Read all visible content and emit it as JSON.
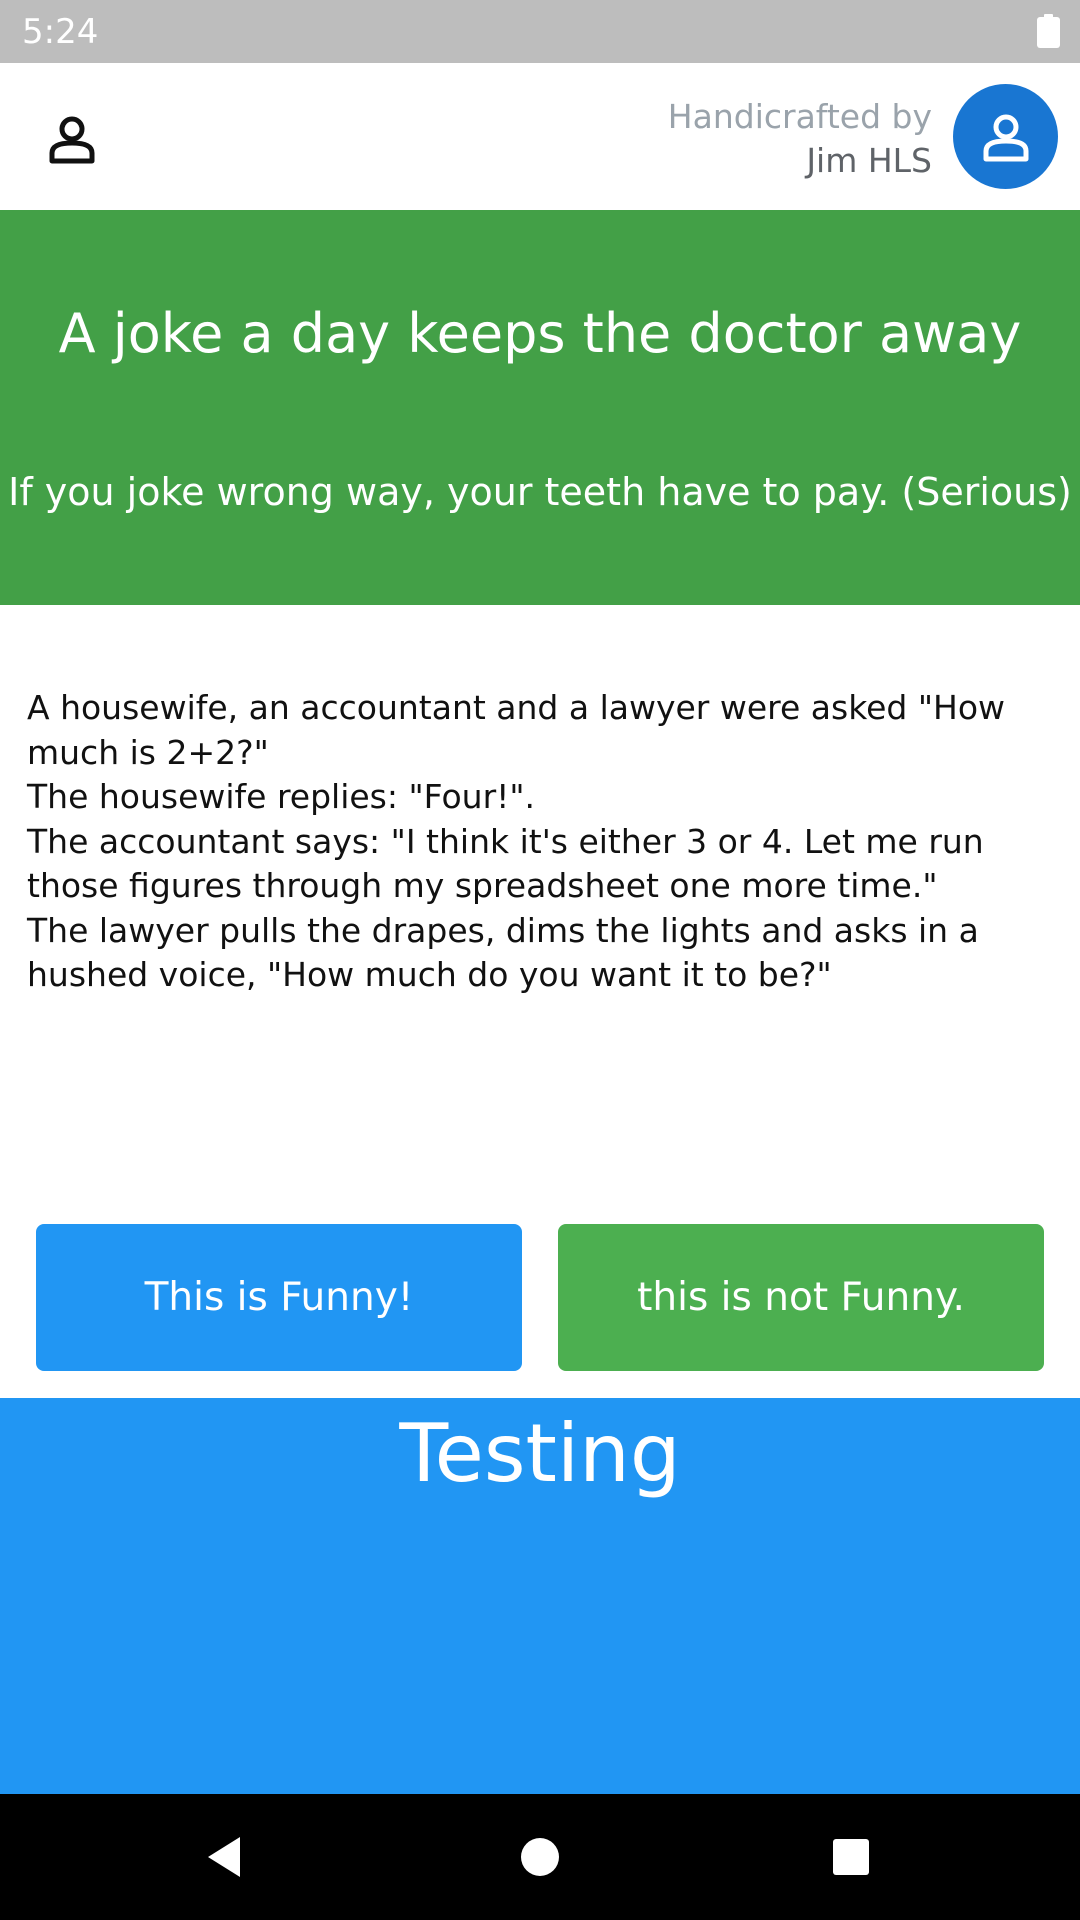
{
  "status_bar": {
    "time": "5:24",
    "battery_icon": "battery-full-icon"
  },
  "header": {
    "left_icon": "user-outline-icon",
    "credit_line1": "Handicrafted by",
    "credit_line2": "Jim HLS",
    "avatar_icon": "user-avatar-icon",
    "avatar_color": "#1976d2"
  },
  "hero": {
    "title": "A joke a day keeps the doctor away",
    "subtitle": "If you joke wrong way, your teeth have to pay. (Serious)",
    "background": "#43a047"
  },
  "joke": {
    "lines": [
      "A housewife, an accountant and a lawyer were asked \"How much is 2+2?\"",
      "The housewife replies: \"Four!\".",
      "The accountant says: \"I think it's either 3 or 4.  Let me run those figures through my spreadsheet one more time.\"",
      "The lawyer pulls the drapes, dims the lights and asks in a hushed voice, \"How much do you want it to be?\""
    ]
  },
  "buttons": {
    "funny_label": "This is Funny!",
    "funny_color": "#2196f3",
    "not_funny_label": "this is not Funny.",
    "not_funny_color": "#4caf50"
  },
  "footer_panel": {
    "label": "Testing",
    "background": "#2196f3"
  },
  "nav_bar": {
    "back_icon": "back-triangle-icon",
    "home_icon": "home-circle-icon",
    "recents_icon": "recents-square-icon"
  }
}
